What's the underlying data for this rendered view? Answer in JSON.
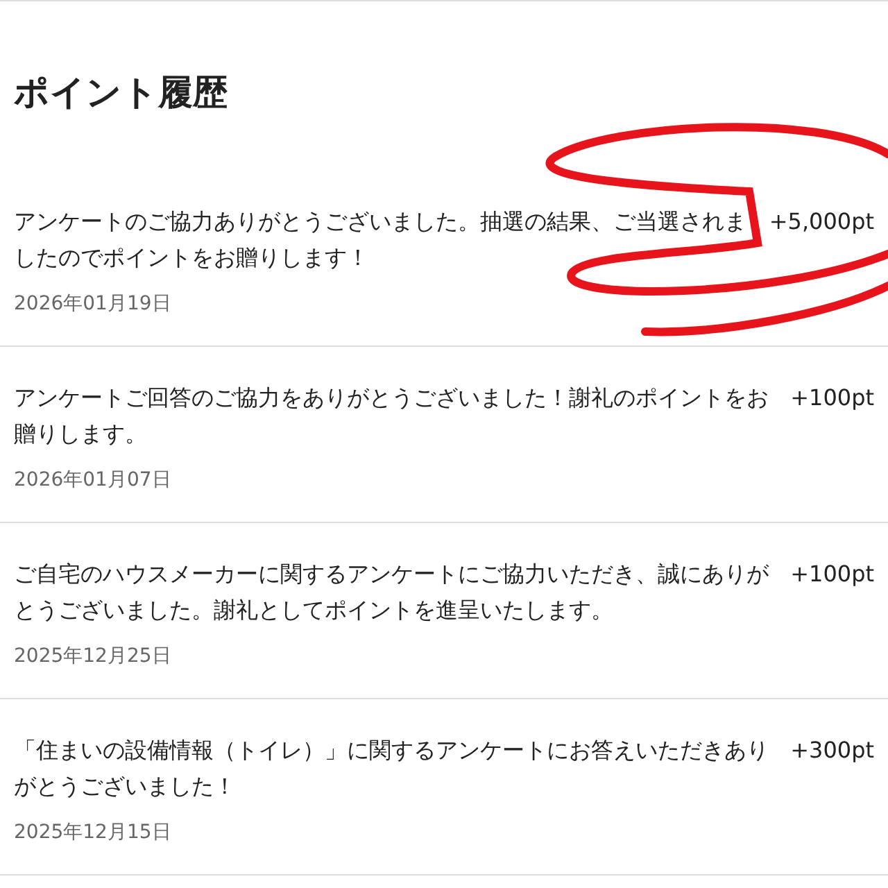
{
  "title": "ポイント履歴",
  "entries": [
    {
      "description": "アンケートのご協力ありがとうございました。抽選の結果、ご当選されましたのでポイントをお贈りします！",
      "points": "+5,000pt",
      "date": "2026年01月19日"
    },
    {
      "description": "アンケートご回答のご協力をありがとうございました！謝礼のポイントをお贈りします。",
      "points": "+100pt",
      "date": "2026年01月07日"
    },
    {
      "description": "ご自宅のハウスメーカーに関するアンケートにご協力いただき、誠にありがとうございました。謝礼としてポイントを進呈いたします。",
      "points": "+100pt",
      "date": "2025年12月25日"
    },
    {
      "description": "「住まいの設備情報（トイレ）」に関するアンケートにお答えいただきありがとうございました！",
      "points": "+300pt",
      "date": "2025年12月15日"
    }
  ]
}
